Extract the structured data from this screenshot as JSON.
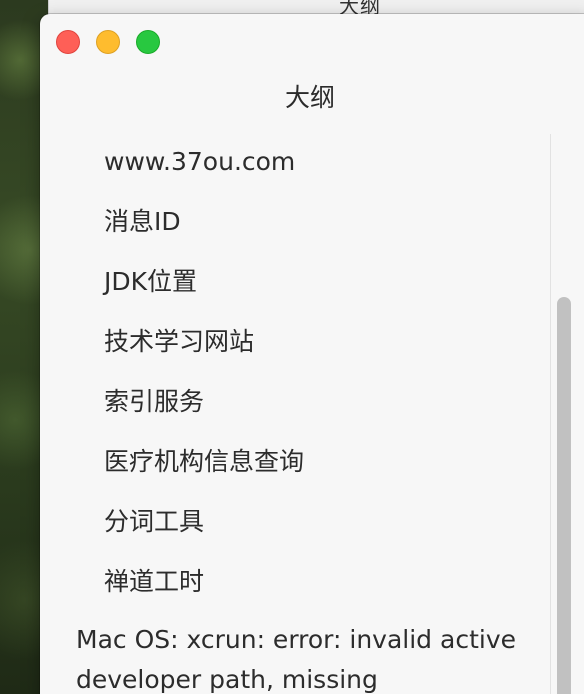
{
  "background_window": {
    "title": "大纲"
  },
  "window": {
    "title": "大纲",
    "controls": {
      "close": "close-icon",
      "minimize": "minimize-icon",
      "zoom": "zoom-icon"
    }
  },
  "outline": {
    "items": [
      {
        "label": "www.37ou.com"
      },
      {
        "label": "消息ID"
      },
      {
        "label": "JDK位置"
      },
      {
        "label": "技术学习网站"
      },
      {
        "label": "索引服务"
      },
      {
        "label": "医疗机构信息查询"
      },
      {
        "label": "分词工具"
      },
      {
        "label": "禅道工时"
      }
    ],
    "top_level_item": "Mac OS: xcrun: error: invalid active developer path, missing"
  },
  "colors": {
    "close": "#fe5f57",
    "minimize": "#febc2e",
    "zoom": "#28c840",
    "window_bg": "#f7f7f7"
  }
}
